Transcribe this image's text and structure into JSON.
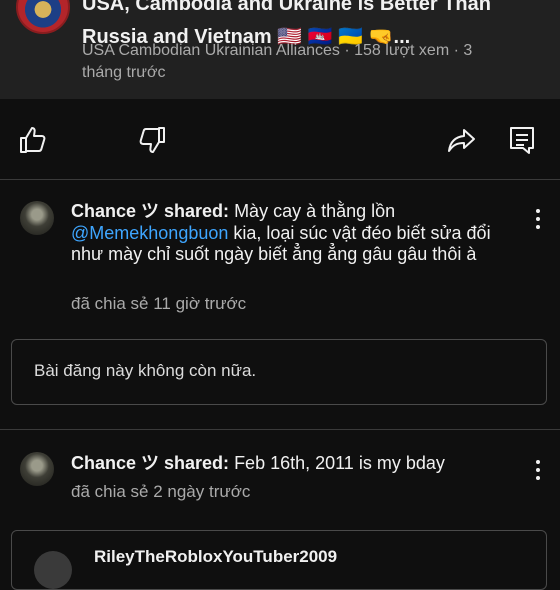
{
  "video": {
    "title": "USA, Cambodia and Ukraine is Better Than Russia and Vietnam 🇺🇸 🇰🇭 🇺🇦 🤜...",
    "channel": "USA Cambodian Ukrainian Alliances",
    "meta": "USA Cambodian Ukrainian Alliances · 158 lượt xem · 3 tháng trước"
  },
  "actions": {
    "icons": [
      "thumbs-up-icon",
      "thumbs-down-icon",
      "share-icon",
      "comment-icon"
    ]
  },
  "posts": [
    {
      "author_line": "Chance ツ shared:",
      "text_before": "Mày cay à thằng lồn ",
      "mention": "@Memekhongbuon",
      "text_after": " kia, loại súc vật đéo biết sửa đổi như mày chỉ suốt ngày biết ẳng ẳng gâu gâu thôi à",
      "time": "đã chia sẻ 11 giờ trước",
      "removed_notice": "Bài đăng này không còn nữa."
    },
    {
      "author_line": "Chance ツ shared:",
      "text": "Feb 16th, 2011 is my bday",
      "time": "đã chia sẻ 2 ngày trước",
      "shared_author": "RileyTheRobloxYouTuber2009"
    }
  ],
  "colors": {
    "background": "#0f0f0f",
    "header_bg": "#212121",
    "mention": "#3ea6ff",
    "secondary_text": "#aaaaaa"
  }
}
